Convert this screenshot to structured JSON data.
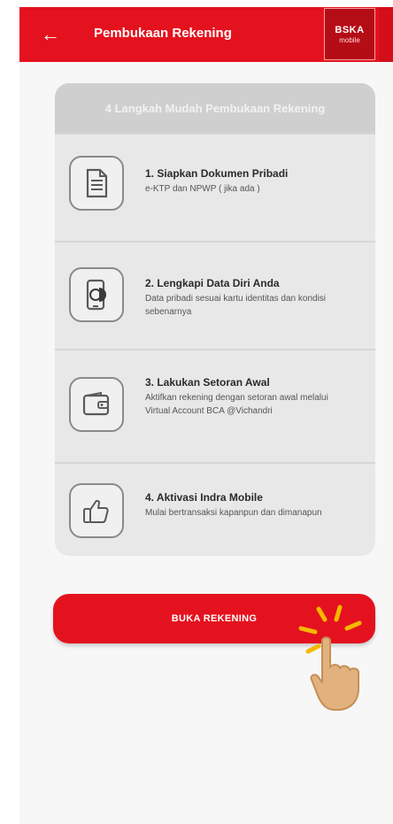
{
  "app_bar": {
    "title": "Pembukaan Rekening",
    "back_icon": "arrow-left-icon",
    "brand_top": "BSKA",
    "brand_bottom": "mobile",
    "color": "#e4121e"
  },
  "steps_card": {
    "header": "4 Langkah Mudah Pembukaan Rekening",
    "steps": [
      {
        "icon": "document-icon",
        "title": "1. Siapkan Dokumen Pribadi",
        "description": "e-KTP dan NPWP ( jika ada )"
      },
      {
        "icon": "phone-data-icon",
        "title": "2. Lengkapi Data Diri Anda",
        "description": "Data pribadi sesuai kartu identitas dan kondisi sebenarnya"
      },
      {
        "icon": "wallet-icon",
        "title": "3. Lakukan Setoran Awal",
        "description": "Aktifkan rekening dengan setoran awal melalui Virtual Account BCA @Vichandri"
      },
      {
        "icon": "thumbs-up-icon",
        "title": "4. Aktivasi Indra Mobile",
        "description": "Mulai bertransaksi kapanpun dan dimanapun"
      }
    ]
  },
  "cta": {
    "label": "BUKA REKENING",
    "hand_icon": "tap-hand-icon"
  }
}
